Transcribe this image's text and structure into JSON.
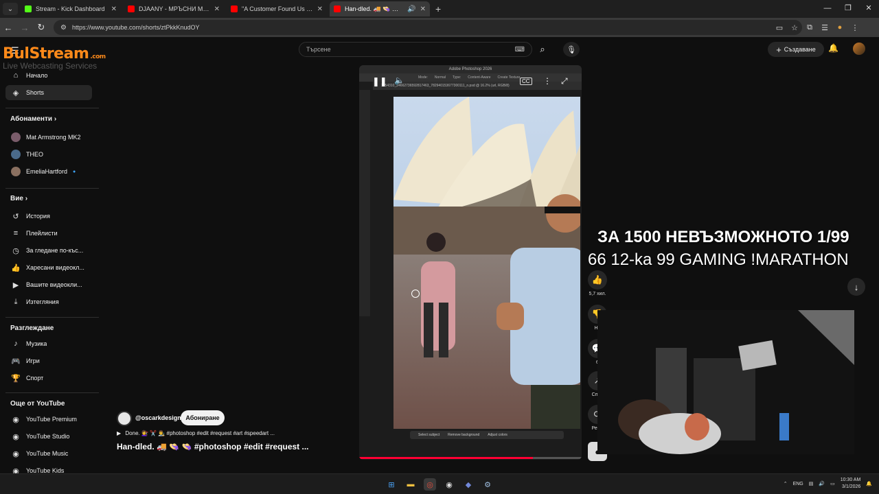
{
  "browser": {
    "tabs": [
      {
        "title": "Stream - Kick Dashboard",
        "favicon_color": "#53fc18",
        "active": false
      },
      {
        "title": "DJAANY - МРЪСНИ МИСЛИ [",
        "favicon_color": "#ff0000",
        "active": false
      },
      {
        "title": "\"A Customer Found Us on Yelp",
        "favicon_color": "#ff0000",
        "active": false
      },
      {
        "title": "Han-dled. 🚚 👒 👒 #photo",
        "favicon_color": "#ff0000",
        "active": true
      }
    ],
    "url": "https://www.youtube.com/shorts/ztPkkKnudOY"
  },
  "overlay_logo": {
    "brand": "BulStream",
    "tagline": "Live Webcasting Services",
    "suffix": ".com"
  },
  "header": {
    "search_placeholder": "Търсене",
    "create_label": "Създаване"
  },
  "sidebar": {
    "main": [
      {
        "label": "Начало",
        "icon": "home-icon"
      },
      {
        "label": "Shorts",
        "icon": "shorts-icon"
      }
    ],
    "subscriptions_title": "Абонаменти",
    "subscriptions": [
      {
        "label": "Mat Armstrong MK2"
      },
      {
        "label": "THEO"
      },
      {
        "label": "EmeliaHartford"
      }
    ],
    "you_title": "Вие",
    "you": [
      {
        "label": "История"
      },
      {
        "label": "Плейлисти"
      },
      {
        "label": "За гледане по-къс..."
      },
      {
        "label": "Харесани видеокл..."
      },
      {
        "label": "Вашите видеокли..."
      },
      {
        "label": "Изтегляния"
      }
    ],
    "explore_title": "Разглеждане",
    "explore": [
      {
        "label": "Музика"
      },
      {
        "label": "Игри"
      },
      {
        "label": "Спорт"
      }
    ],
    "more_title": "Още от YouTube",
    "more": [
      {
        "label": "YouTube Premium"
      },
      {
        "label": "YouTube Studio"
      },
      {
        "label": "YouTube Music"
      },
      {
        "label": "YouTube Kids"
      }
    ]
  },
  "short": {
    "ps_window_title": "Adobe Photoshop 2026",
    "ps_options": [
      "Mode:",
      "Normal",
      "Type:",
      "Content-Aware",
      "Create Texture"
    ],
    "ps_filename": "1654310_24662736592817463_782940153677300111_n.psd @ 16.2% (url, RGB/8)",
    "ps_bottom_actions": [
      "Select subject",
      "Remove background",
      "Adjust colors"
    ],
    "progress": 0.78,
    "channel": "@oscarkdesign",
    "subscribe_label": "Абониране",
    "description": "Done. 💇‍♀️ ✂️ 👨‍🎨 #photoshop #edit #request #art #speedart ...",
    "title": "Han-dled. 🚚 👒 👒 #photoshop #edit #request ...",
    "cc_label": "CC"
  },
  "actions": {
    "likes": "5,7 хил.",
    "dislike_label": "Не",
    "comments": "6",
    "share_label": "Спод",
    "remix_label": "Реми"
  },
  "stream_overlay": {
    "line1": "ЗА 1500 НЕВЪЗМОЖНОТО 1/99",
    "line2": "66 12-ka 99 GAMING !MARATHON"
  },
  "taskbar": {
    "lang": "ENG",
    "time": "10:30 AM",
    "date": "3/1/2026"
  }
}
